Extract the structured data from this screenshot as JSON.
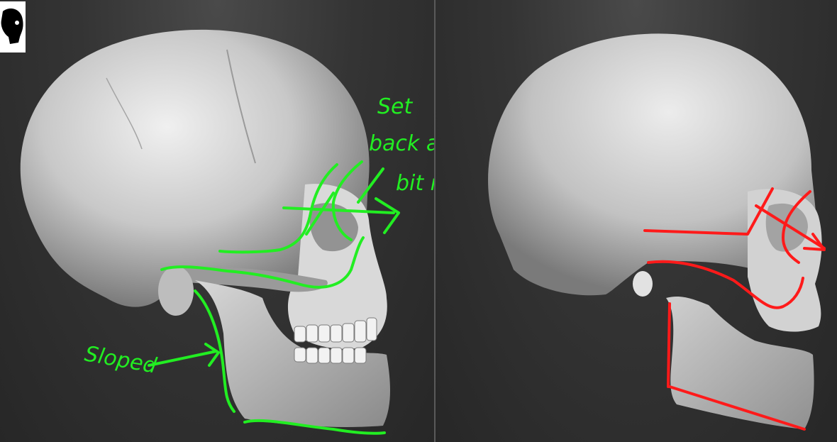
{
  "viewport_left": {
    "annotations": [
      "Set",
      "back a",
      "bit more",
      "Sloped"
    ],
    "annotation_color": "#22ee22"
  },
  "viewport_right": {
    "annotation_color": "#ff1a1a"
  },
  "thumbnail": {
    "icon": "skull-profile-icon"
  },
  "colors": {
    "background": "#2e2e2e",
    "bone_light": "#e8e8e8",
    "bone_shadow": "#8c8c8c"
  }
}
